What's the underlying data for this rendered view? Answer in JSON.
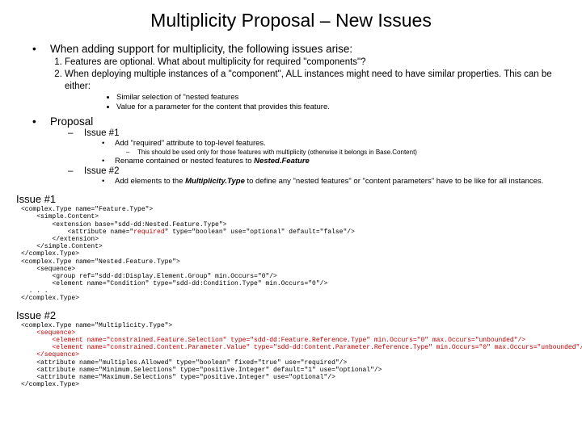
{
  "title": "Multiplicity Proposal – New Issues",
  "intro": "When adding support for multiplicity, the following issues arise:",
  "num1": "Features are optional.  What about multiplicity for required \"components\"?",
  "num2": "When deploying multiple instances of a \"component\", ALL instances might need to have similar properties.  This can be either:",
  "sim1": "Similar selection of \"nested features",
  "sim2": "Value for a parameter for the content that provides this feature.",
  "proposal": "Proposal",
  "issue1": "Issue #1",
  "issue2": "Issue #2",
  "p1a": "Add \"required\" attribute to top-level features.",
  "p1a_note": "This should be used only for those features with multiplicity (otherwise it belongs in Base.Content)",
  "p1b_pre": "Rename contained or nested features to ",
  "p1b_bold": "Nested.Feature",
  "p2a_pre": "Add elements to the ",
  "p2a_bold": "Multiplicity.Type",
  "p2a_post": " to define any \"nested features\" or \"content parameters\" have to be like for all instances.",
  "issue1_label": "Issue #1",
  "issue2_label": "Issue #2",
  "code1_l1": "<complex.Type name=\"Feature.Type\">",
  "code1_l2": "    <simple.Content>",
  "code1_l3": "        <extension base=\"sdd-dd:Nested.Feature.Type\">",
  "code1_l4_a": "            <attribute name=\"",
  "code1_l4_r": "required",
  "code1_l4_b": "\" type=\"boolean\" use=\"optional\" default=\"false\"/>",
  "code1_l5": "        </extension>",
  "code1_l6": "    </simple.Content>",
  "code1_l7": "</complex.Type>",
  "code1_l8": "<complex.Type name=\"Nested.Feature.Type\">",
  "code1_l9": "    <sequence>",
  "code1_l10": "        <group ref=\"sdd-dd:Display.Element.Group\" min.Occurs=\"0\"/>",
  "code1_l11": "        <element name=\"Condition\" type=\"sdd-dd:Condition.Type\" min.Occurs=\"0\"/>",
  "code1_l12": "  . . .",
  "code1_l13": "</complex.Type>",
  "code2_l1": "<complex.Type name=\"Multiplicity.Type\">",
  "code2_l2a": "    <sequence>",
  "code2_l2b": "        <element name=\"constrained.Feature.Selection\" type=\"sdd-dd:Feature.Reference.Type\" min.Occurs=\"0\" max.Occurs=\"unbounded\"/>",
  "code2_l2c": "        <element name=\"constrained.Content.Parameter.Value\" type=\"sdd-dd:Content.Parameter.Reference.Type\" min.Occurs=\"0\" max.Occurs=\"unbounded\"/>",
  "code2_l2d": "    </sequence>",
  "code2_l3": "    <attribute name=\"multiples.Allowed\" type=\"boolean\" fixed=\"true\" use=\"required\"/>",
  "code2_l4": "    <attribute name=\"Minimum.Selections\" type=\"positive.Integer\" default=\"1\" use=\"optional\"/>",
  "code2_l5": "    <attribute name=\"Maximum.Selections\" type=\"positive.Integer\" use=\"optional\"/>",
  "code2_l6": "</complex.Type>"
}
